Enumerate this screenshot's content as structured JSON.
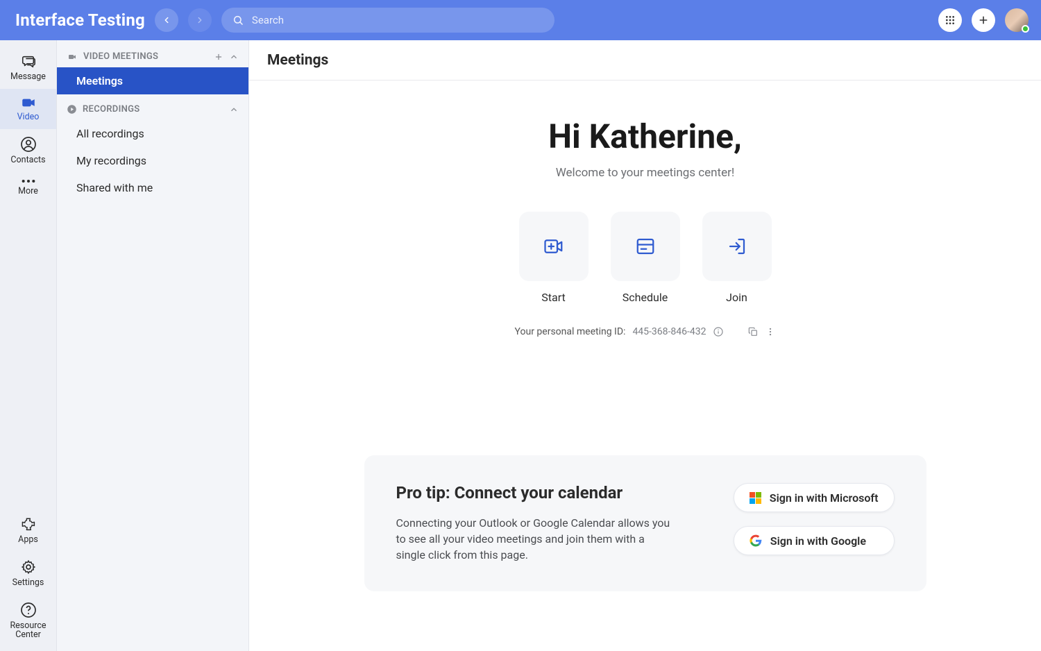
{
  "header": {
    "brand": "Interface Testing",
    "search_placeholder": "Search"
  },
  "rail": {
    "message": "Message",
    "video": "Video",
    "contacts": "Contacts",
    "more": "More",
    "apps": "Apps",
    "settings": "Settings",
    "resource_center": "Resource\nCenter"
  },
  "panel": {
    "section_video": "VIDEO MEETINGS",
    "meetings": "Meetings",
    "section_rec": "RECORDINGS",
    "rec_all": "All recordings",
    "rec_my": "My recordings",
    "rec_shared": "Shared with me"
  },
  "main": {
    "title": "Meetings",
    "greeting": "Hi Katherine,",
    "sub": "Welcome to your meetings center!",
    "actions": {
      "start": "Start",
      "schedule": "Schedule",
      "join": "Join"
    },
    "pmi_label": "Your personal meeting ID:",
    "pmi_value": "445-368-846-432",
    "tip": {
      "title": "Pro tip: Connect your calendar",
      "body": "Connecting your Outlook or Google Calendar allows you to see all your video meetings and join them with a single click from this page.",
      "ms": "Sign in with Microsoft",
      "google": "Sign in with Google"
    }
  }
}
